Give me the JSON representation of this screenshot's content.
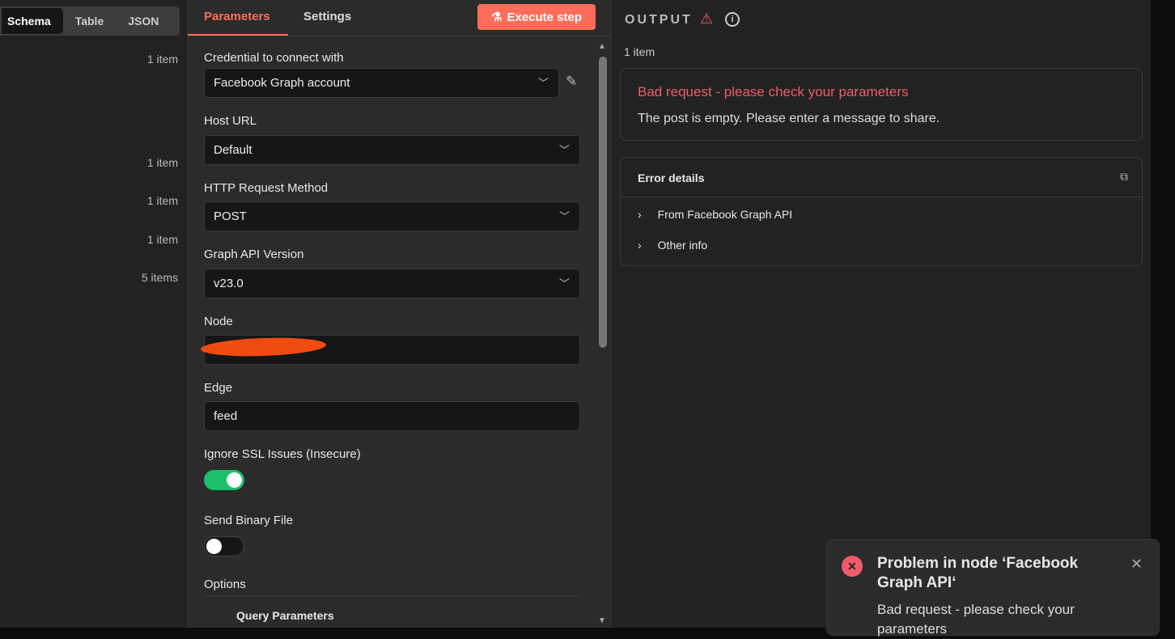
{
  "left": {
    "tabs": [
      "Schema",
      "Table",
      "JSON"
    ],
    "counts": [
      "1 item",
      "1 item",
      "1 item",
      "1 item",
      "5 items"
    ]
  },
  "params": {
    "tabs": [
      "Parameters",
      "Settings"
    ],
    "execute": "Execute step",
    "fields": [
      {
        "label": "Credential to connect with",
        "value": "Facebook Graph account"
      },
      {
        "label": "Host URL",
        "value": "Default"
      },
      {
        "label": "HTTP Request Method",
        "value": "POST"
      },
      {
        "label": "Graph API Version",
        "value": "v23.0"
      },
      {
        "label": "Node",
        "value": ""
      },
      {
        "label": "Edge",
        "value": "feed"
      }
    ],
    "ssl_label": "Ignore SSL Issues (Insecure)",
    "ssl_on": true,
    "binary_label": "Send Binary File",
    "binary_on": false,
    "options_label": "Options",
    "query_params": "Query Parameters"
  },
  "output": {
    "title": "OUTPUT",
    "count": "1 item",
    "error_title": "Bad request - please check your parameters",
    "error_msg": "The post is empty. Please enter a message to share.",
    "details_title": "Error details",
    "details": [
      "From Facebook Graph API",
      "Other info"
    ]
  },
  "toast": {
    "title": "Problem in node ‘Facebook Graph API‘",
    "body": "Bad request - please check your parameters"
  },
  "colors": {
    "accent": "#ff6d5a",
    "error": "#f25c6a",
    "toggle_on": "#1ac06b"
  }
}
